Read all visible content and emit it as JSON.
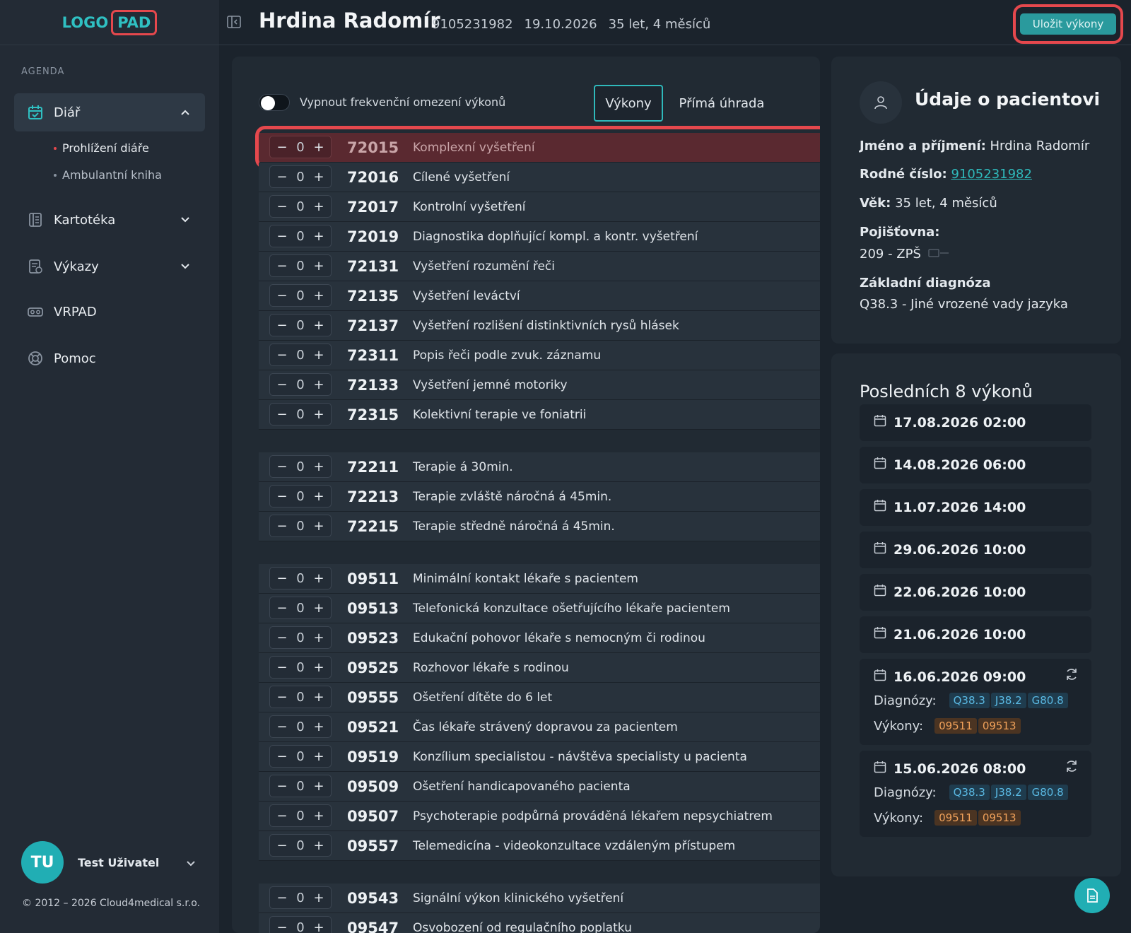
{
  "logo": {
    "part1": "LOGO",
    "part2": "PAD"
  },
  "sidebar": {
    "section": "AGENDA",
    "items": [
      {
        "label": "Diář",
        "icon": "calendar-icon"
      },
      {
        "label": "Kartotéka",
        "icon": "card-file-icon"
      },
      {
        "label": "Výkazy",
        "icon": "report-icon"
      },
      {
        "label": "VRPAD",
        "icon": "vr-headset-icon"
      },
      {
        "label": "Pomoc",
        "icon": "lifebuoy-icon"
      }
    ],
    "subitems": [
      "Prohlížení diáře",
      "Ambulantní kniha"
    ]
  },
  "user": {
    "initials": "TU",
    "name": "Test Uživatel"
  },
  "copyright": "© 2012 – 2026 Cloud4medical s.r.o.",
  "header": {
    "patient_name": "Hrdina Radomír",
    "birth_number": "9105231982",
    "date": "19.10.2026",
    "age": "35 let, 4 měsíců",
    "save_label": "Uložit výkony"
  },
  "main": {
    "toggle_label": "Vypnout frekvenční omezení výkonů",
    "tabs": [
      "Výkony",
      "Přímá úhrada"
    ],
    "groups": [
      [
        {
          "qty": "0",
          "code": "72015",
          "name": "Komplexní vyšetření"
        },
        {
          "qty": "0",
          "code": "72016",
          "name": "Cílené vyšetření"
        },
        {
          "qty": "0",
          "code": "72017",
          "name": "Kontrolní vyšetření"
        },
        {
          "qty": "0",
          "code": "72019",
          "name": "Diagnostika doplňující kompl. a kontr. vyšetření"
        },
        {
          "qty": "0",
          "code": "72131",
          "name": "Vyšetření rozumění řeči"
        },
        {
          "qty": "0",
          "code": "72135",
          "name": "Vyšetření leváctví"
        },
        {
          "qty": "0",
          "code": "72137",
          "name": "Vyšetření rozlišení distinktivních rysů hlásek"
        },
        {
          "qty": "0",
          "code": "72311",
          "name": "Popis řeči podle zvuk. záznamu"
        },
        {
          "qty": "0",
          "code": "72133",
          "name": "Vyšetření jemné motoriky"
        },
        {
          "qty": "0",
          "code": "72315",
          "name": "Kolektivní terapie ve foniatrii"
        }
      ],
      [
        {
          "qty": "0",
          "code": "72211",
          "name": "Terapie á 30min."
        },
        {
          "qty": "0",
          "code": "72213",
          "name": "Terapie zvláště náročná á 45min."
        },
        {
          "qty": "0",
          "code": "72215",
          "name": "Terapie středně náročná á 45min."
        }
      ],
      [
        {
          "qty": "0",
          "code": "09511",
          "name": "Minimální kontakt lékaře s pacientem"
        },
        {
          "qty": "0",
          "code": "09513",
          "name": "Telefonická konzultace ošetřujícího lékaře pacientem"
        },
        {
          "qty": "0",
          "code": "09523",
          "name": "Edukační pohovor lékaře s nemocným či rodinou"
        },
        {
          "qty": "0",
          "code": "09525",
          "name": "Rozhovor lékaře s rodinou"
        },
        {
          "qty": "0",
          "code": "09555",
          "name": "Ošetření dítěte do 6 let"
        },
        {
          "qty": "0",
          "code": "09521",
          "name": "Čas lékaře strávený dopravou za pacientem"
        },
        {
          "qty": "0",
          "code": "09519",
          "name": "Konzílium specialistou - návštěva specialisty u pacienta"
        },
        {
          "qty": "0",
          "code": "09509",
          "name": "Ošetření handicapovaného pacienta"
        },
        {
          "qty": "0",
          "code": "09507",
          "name": "Psychoterapie podpůrná prováděná lékařem nepsychiatrem"
        },
        {
          "qty": "0",
          "code": "09557",
          "name": "Telemedicína - videokonzultace vzdáleným přístupem"
        }
      ],
      [
        {
          "qty": "0",
          "code": "09543",
          "name": "Signální výkon klinického vyšetření"
        },
        {
          "qty": "0",
          "code": "09547",
          "name": "Osvobození od regulačního poplatku"
        }
      ]
    ]
  },
  "patient_info": {
    "title": "Údaje o pacientovi",
    "name_label": "Jméno a příjmení:",
    "name_value": "Hrdina Radomír",
    "birth_label": "Rodné číslo:",
    "birth_value": "9105231982",
    "age_label": "Věk:",
    "age_value": "35 let, 4 měsíců",
    "insurance_label": "Pojišťovna:",
    "insurance_value": "209 - ZPŠ",
    "diagnosis_label": "Základní diagnóza",
    "diagnosis_value": "Q38.3 - Jiné vrozené vady jazyka"
  },
  "recent": {
    "title": "Posledních 8 výkonů",
    "diag_label": "Diagnózy:",
    "proc_label": "Výkony:",
    "items": [
      {
        "date": "17.08.2026 02:00"
      },
      {
        "date": "14.08.2026 06:00"
      },
      {
        "date": "11.07.2026 14:00"
      },
      {
        "date": "29.06.2026 10:00"
      },
      {
        "date": "22.06.2026 10:00"
      },
      {
        "date": "21.06.2026 10:00"
      },
      {
        "date": "16.06.2026 09:00",
        "diagnoses": [
          "Q38.3",
          "J38.2",
          "G80.8"
        ],
        "procedures": [
          "09511",
          "09513"
        ]
      },
      {
        "date": "15.06.2026 08:00",
        "diagnoses": [
          "Q38.3",
          "J38.2",
          "G80.8"
        ],
        "procedures": [
          "09511",
          "09513"
        ]
      }
    ]
  },
  "colors": {
    "accent": "#2fb9bb",
    "highlight": "#e5484d",
    "background": "#1b232c"
  }
}
